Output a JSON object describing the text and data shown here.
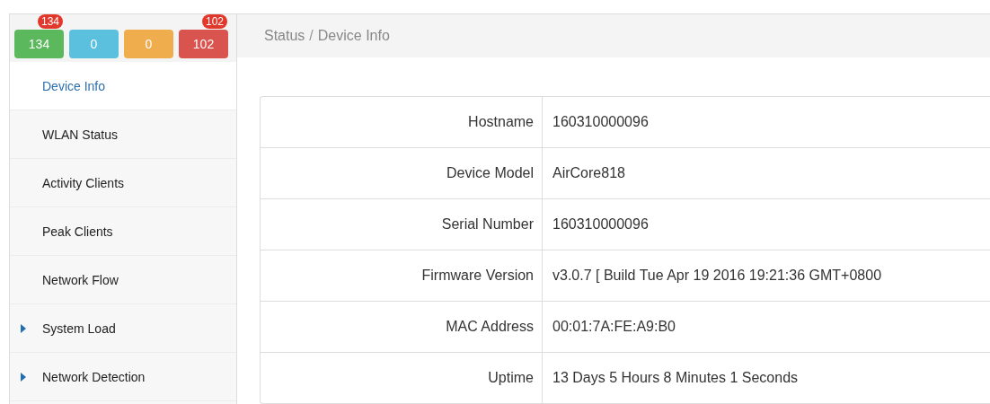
{
  "counters": [
    {
      "value": "134",
      "color": "#5cb85c",
      "badge": "134"
    },
    {
      "value": "0",
      "color": "#5bc0de"
    },
    {
      "value": "0",
      "color": "#f0ad4e"
    },
    {
      "value": "102",
      "color": "#d9534f",
      "badge": "102"
    }
  ],
  "breadcrumb": [
    "Status",
    "Device Info"
  ],
  "breadcrumb_separator": "/",
  "sidebar": {
    "items": [
      {
        "label": "Device Info",
        "selected": true,
        "expandable": false
      },
      {
        "label": "WLAN Status",
        "selected": false,
        "expandable": false
      },
      {
        "label": "Activity Clients",
        "selected": false,
        "expandable": false
      },
      {
        "label": "Peak Clients",
        "selected": false,
        "expandable": false
      },
      {
        "label": "Network Flow",
        "selected": false,
        "expandable": false
      },
      {
        "label": "System Load",
        "selected": false,
        "expandable": true
      },
      {
        "label": "Network Detection",
        "selected": false,
        "expandable": true
      }
    ]
  },
  "table": {
    "rows": [
      {
        "label": "Hostname",
        "value": "160310000096"
      },
      {
        "label": "Device Model",
        "value": "AirCore818"
      },
      {
        "label": "Serial Number",
        "value": "160310000096"
      },
      {
        "label": "Firmware Version",
        "value": "v3.0.7 [ Build Tue Apr 19 2016 19:21:36 GMT+0800"
      },
      {
        "label": "MAC Address",
        "value": "00:01:7A:FE:A9:B0"
      },
      {
        "label": "Uptime",
        "value": "13 Days 5 Hours 8 Minutes 1 Seconds"
      }
    ]
  }
}
